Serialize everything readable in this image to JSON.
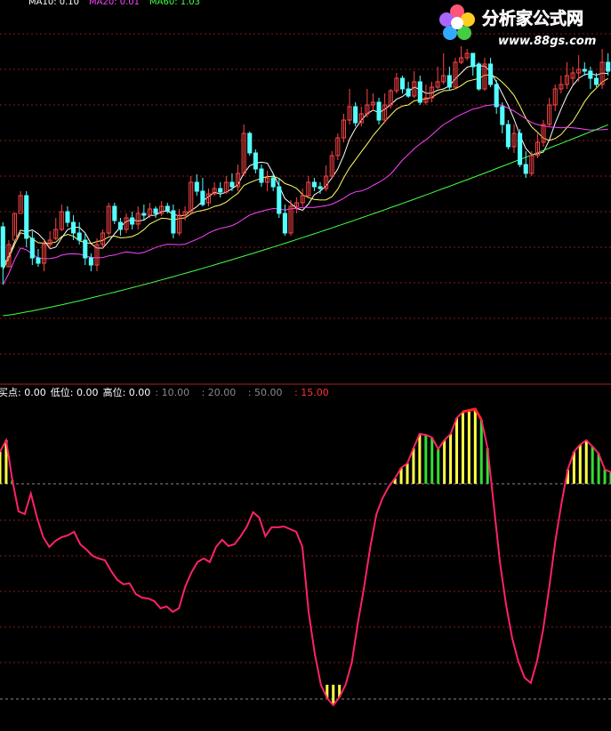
{
  "legend_top": {
    "items": [
      {
        "text": "MA10: 0.10",
        "color": "#ffffff"
      },
      {
        "text": "MA20: 0.01",
        "color": "#ff44ff"
      },
      {
        "text": "MA60: 1.03",
        "color": "#44ff44"
      }
    ]
  },
  "legend_osc": {
    "items": [
      {
        "text": "买点: 0.00",
        "color": "#ffffff"
      },
      {
        "text": "低位: 0.00",
        "color": "#ffffff"
      },
      {
        "text": "高位: 0.00",
        "color": "#ffffff"
      },
      {
        "text": ": 10.00",
        "color": "#888888"
      },
      {
        "text": ": 20.00",
        "color": "#888888"
      },
      {
        "text": ": 50.00",
        "color": "#888888"
      },
      {
        "text": ": 15.00",
        "color": "#ff3333"
      }
    ]
  },
  "watermark": {
    "brand": "分析家公式网",
    "url": "www.88gs.com"
  },
  "colors": {
    "up": "#ff4444",
    "down": "#54ffff",
    "ma5": "#ffffff",
    "ma10": "#ffff66",
    "ma20": "#ff44ff",
    "ma60": "#44ff44",
    "osc_line": "#ff2266",
    "bar_yellow": "#ffff44",
    "bar_green": "#33dd33",
    "bar_red": "#ff2222",
    "grid": "#8a1a1a",
    "divider": "#aa2222"
  },
  "chart_data": [
    {
      "type": "candlestick",
      "title": "",
      "candles": [
        [
          255,
          300,
          320,
          250
        ],
        [
          300,
          275,
          300,
          270
        ],
        [
          270,
          240,
          265,
          240
        ],
        [
          240,
          220,
          238,
          215
        ],
        [
          220,
          268,
          278,
          215
        ],
        [
          268,
          290,
          298,
          260
        ],
        [
          290,
          296,
          300,
          280
        ],
        [
          296,
          275,
          305,
          270
        ],
        [
          275,
          270,
          280,
          260
        ],
        [
          268,
          258,
          270,
          245
        ],
        [
          258,
          238,
          260,
          230
        ],
        [
          238,
          250,
          255,
          232
        ],
        [
          250,
          262,
          270,
          242
        ],
        [
          262,
          270,
          275,
          250
        ],
        [
          270,
          290,
          298,
          262
        ],
        [
          290,
          298,
          305,
          285
        ],
        [
          298,
          275,
          305,
          268
        ],
        [
          275,
          262,
          280,
          258
        ],
        [
          262,
          232,
          265,
          228
        ],
        [
          232,
          248,
          252,
          228
        ],
        [
          250,
          258,
          265,
          245
        ],
        [
          258,
          245,
          262,
          240
        ],
        [
          245,
          252,
          258,
          238
        ],
        [
          252,
          240,
          258,
          232
        ],
        [
          240,
          242,
          248,
          230
        ],
        [
          242,
          235,
          245,
          228
        ],
        [
          235,
          240,
          245,
          232
        ],
        [
          240,
          232,
          243,
          226
        ],
        [
          232,
          237,
          240,
          228
        ],
        [
          237,
          262,
          268,
          230
        ],
        [
          262,
          242,
          265,
          235
        ],
        [
          242,
          238,
          248,
          232
        ],
        [
          238,
          205,
          240,
          198
        ],
        [
          205,
          215,
          220,
          196
        ],
        [
          215,
          230,
          232,
          200
        ],
        [
          228,
          218,
          232,
          212
        ],
        [
          218,
          212,
          220,
          205
        ],
        [
          212,
          216,
          222,
          205
        ],
        [
          216,
          205,
          218,
          198
        ],
        [
          205,
          210,
          215,
          195
        ],
        [
          210,
          195,
          215,
          185
        ],
        [
          195,
          150,
          198,
          140
        ],
        [
          150,
          172,
          175,
          148
        ],
        [
          172,
          190,
          195,
          168
        ],
        [
          190,
          205,
          210,
          185
        ],
        [
          205,
          200,
          215,
          192
        ],
        [
          200,
          210,
          215,
          195
        ],
        [
          210,
          240,
          245,
          200
        ],
        [
          240,
          262,
          265,
          230
        ],
        [
          262,
          232,
          265,
          225
        ],
        [
          232,
          228,
          240,
          222
        ],
        [
          228,
          220,
          232,
          212
        ],
        [
          220,
          205,
          222,
          198
        ],
        [
          205,
          210,
          215,
          200
        ],
        [
          210,
          212,
          218,
          205
        ],
        [
          212,
          198,
          215,
          186
        ],
        [
          198,
          175,
          200,
          170
        ],
        [
          175,
          155,
          180,
          150
        ],
        [
          155,
          135,
          160,
          128
        ],
        [
          135,
          120,
          140,
          100
        ],
        [
          120,
          138,
          142,
          115
        ],
        [
          138,
          128,
          142,
          120
        ],
        [
          128,
          118,
          132,
          100
        ],
        [
          118,
          115,
          125,
          105
        ],
        [
          115,
          135,
          140,
          110
        ],
        [
          135,
          118,
          138,
          105
        ],
        [
          118,
          102,
          122,
          100
        ],
        [
          102,
          88,
          105,
          82
        ],
        [
          88,
          100,
          105,
          85
        ],
        [
          100,
          108,
          110,
          92
        ],
        [
          108,
          92,
          110,
          80
        ],
        [
          92,
          115,
          118,
          85
        ],
        [
          115,
          110,
          118,
          95
        ],
        [
          110,
          98,
          115,
          92
        ],
        [
          98,
          92,
          100,
          75
        ],
        [
          92,
          85,
          95,
          60
        ],
        [
          85,
          98,
          102,
          75
        ],
        [
          98,
          70,
          100,
          65
        ],
        [
          70,
          65,
          72,
          52
        ],
        [
          65,
          60,
          68,
          55
        ],
        [
          60,
          75,
          85,
          62
        ],
        [
          72,
          100,
          102,
          70
        ],
        [
          100,
          72,
          102,
          65
        ],
        [
          72,
          95,
          98,
          65
        ],
        [
          95,
          120,
          128,
          90
        ],
        [
          120,
          140,
          150,
          115
        ],
        [
          140,
          165,
          168,
          135
        ],
        [
          165,
          150,
          172,
          140
        ],
        [
          150,
          185,
          188,
          145
        ],
        [
          185,
          195,
          200,
          170
        ],
        [
          195,
          175,
          198,
          170
        ],
        [
          175,
          160,
          178,
          150
        ],
        [
          160,
          140,
          165,
          135
        ],
        [
          140,
          118,
          142,
          110
        ],
        [
          118,
          100,
          125,
          95
        ],
        [
          100,
          95,
          105,
          85
        ],
        [
          95,
          85,
          100,
          70
        ],
        [
          88,
          82,
          95,
          75
        ],
        [
          82,
          78,
          92,
          62
        ],
        [
          78,
          80,
          85,
          70
        ],
        [
          80,
          88,
          100,
          75
        ],
        [
          88,
          95,
          98,
          82
        ],
        [
          95,
          70,
          100,
          55
        ],
        [
          70,
          80,
          85,
          60
        ]
      ]
    },
    {
      "type": "line",
      "title": "",
      "series_line": [
        508,
        495,
        540,
        575,
        578,
        555,
        582,
        604,
        615,
        608,
        604,
        602,
        598,
        612,
        618,
        625,
        628,
        630,
        642,
        652,
        657,
        656,
        668,
        672,
        673,
        676,
        684,
        682,
        688,
        684,
        660,
        644,
        632,
        628,
        632,
        615,
        607,
        614,
        612,
        603,
        592,
        576,
        582,
        603,
        593,
        593,
        592,
        595,
        598,
        615,
        688,
        735,
        770,
        785,
        793,
        784,
        770,
        745,
        700,
        660,
        615,
        578,
        560,
        547,
        538,
        526,
        521,
        504,
        488,
        489,
        492,
        505,
        495,
        488,
        470,
        463,
        462,
        460,
        472,
        504,
        568,
        632,
        680,
        718,
        744,
        762,
        768,
        744,
        708,
        660,
        608,
        565,
        528,
        508,
        500,
        495,
        502,
        510,
        528,
        531
      ],
      "xlim": [
        0,
        99
      ],
      "levels": [
        10,
        20,
        50,
        15
      ]
    }
  ]
}
